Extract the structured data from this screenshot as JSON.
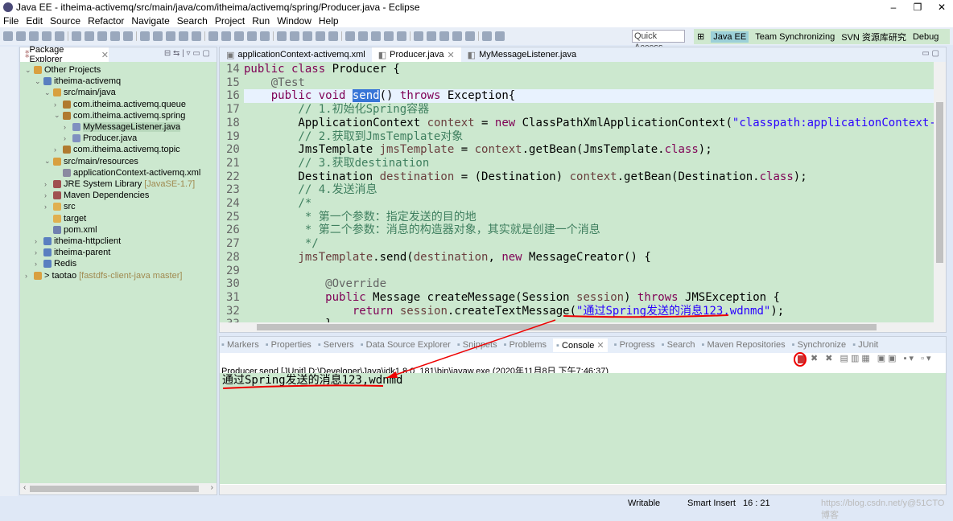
{
  "window": {
    "title": "Java EE - itheima-activemq/src/main/java/com/itheima/activemq/spring/Producer.java - Eclipse"
  },
  "menu": [
    "File",
    "Edit",
    "Source",
    "Refactor",
    "Navigate",
    "Search",
    "Project",
    "Run",
    "Window",
    "Help"
  ],
  "quick_access": "Quick Access",
  "perspectives": [
    "Java EE",
    "Team Synchronizing",
    "SVN 资源库研究",
    "Debug"
  ],
  "package_explorer": {
    "title": "Package Explorer",
    "tree": [
      {
        "label": "Other Projects",
        "depth": 0,
        "expanded": true,
        "icon": "working-set-icon"
      },
      {
        "label": "itheima-activemq",
        "depth": 1,
        "expanded": true,
        "icon": "project-icon"
      },
      {
        "label": "src/main/java",
        "depth": 2,
        "expanded": true,
        "icon": "source-folder-icon"
      },
      {
        "label": "com.itheima.activemq.queue",
        "depth": 3,
        "expanded": false,
        "icon": "package-icon"
      },
      {
        "label": "com.itheima.activemq.spring",
        "depth": 3,
        "expanded": true,
        "icon": "package-icon"
      },
      {
        "label": "MyMessageListener.java",
        "depth": 4,
        "expanded": false,
        "icon": "java-file-icon",
        "selected": true
      },
      {
        "label": "Producer.java",
        "depth": 4,
        "expanded": false,
        "icon": "java-file-icon"
      },
      {
        "label": "com.itheima.activemq.topic",
        "depth": 3,
        "expanded": false,
        "icon": "package-icon"
      },
      {
        "label": "src/main/resources",
        "depth": 2,
        "expanded": true,
        "icon": "source-folder-icon"
      },
      {
        "label": "applicationContext-activemq.xml",
        "depth": 3,
        "icon": "xml-file-icon"
      },
      {
        "label": "JRE System Library",
        "decoration": "[JavaSE-1.7]",
        "depth": 2,
        "expanded": false,
        "icon": "library-icon"
      },
      {
        "label": "Maven Dependencies",
        "depth": 2,
        "expanded": false,
        "icon": "library-icon"
      },
      {
        "label": "src",
        "depth": 2,
        "expanded": false,
        "icon": "folder-icon"
      },
      {
        "label": "target",
        "depth": 2,
        "icon": "folder-icon"
      },
      {
        "label": "pom.xml",
        "depth": 2,
        "icon": "pom-file-icon"
      },
      {
        "label": "itheima-httpclient",
        "depth": 1,
        "expanded": false,
        "icon": "project-icon"
      },
      {
        "label": "itheima-parent",
        "depth": 1,
        "expanded": false,
        "icon": "project-icon"
      },
      {
        "label": "Redis",
        "depth": 1,
        "expanded": false,
        "icon": "project-icon"
      },
      {
        "label": "> taotao",
        "decoration": "[fastdfs-client-java master]",
        "depth": 0,
        "expanded": false,
        "icon": "working-set-icon"
      }
    ]
  },
  "editor": {
    "tabs": [
      {
        "label": "applicationContext-activemq.xml"
      },
      {
        "label": "Producer.java",
        "active": true
      },
      {
        "label": "MyMessageListener.java"
      }
    ],
    "lines": [
      {
        "n": "14",
        "t": [
          [
            "k",
            "public class "
          ],
          [
            "p",
            "Producer {"
          ]
        ]
      },
      {
        "n": "15",
        "t": [
          [
            "p",
            "    "
          ],
          [
            "a",
            "@Test"
          ]
        ]
      },
      {
        "n": "16",
        "cur": true,
        "t": [
          [
            "p",
            "    "
          ],
          [
            "k",
            "public void "
          ],
          [
            "h",
            "send"
          ],
          [
            "p",
            "() "
          ],
          [
            "k",
            "throws "
          ],
          [
            "p",
            "Exception{"
          ]
        ]
      },
      {
        "n": "17",
        "t": [
          [
            "c",
            "        // 1.初始化Spring容器"
          ]
        ]
      },
      {
        "n": "18",
        "t": [
          [
            "p",
            "        ApplicationContext "
          ],
          [
            "v",
            "context"
          ],
          [
            "p",
            " = "
          ],
          [
            "k",
            "new "
          ],
          [
            "p",
            "ClassPathXmlApplicationContext("
          ],
          [
            "s",
            "\"classpath:applicationContext-activemq.xml\""
          ],
          [
            "p",
            ");"
          ]
        ]
      },
      {
        "n": "19",
        "t": [
          [
            "c",
            "        // 2.获取到JmsTemplate对象"
          ]
        ]
      },
      {
        "n": "20",
        "t": [
          [
            "p",
            "        JmsTemplate "
          ],
          [
            "v",
            "jmsTemplate"
          ],
          [
            "p",
            " = "
          ],
          [
            "v",
            "context"
          ],
          [
            "p",
            ".getBean(JmsTemplate."
          ],
          [
            "k",
            "class"
          ],
          [
            "p",
            ");"
          ]
        ]
      },
      {
        "n": "21",
        "t": [
          [
            "c",
            "        // 3.获取destination"
          ]
        ]
      },
      {
        "n": "22",
        "t": [
          [
            "p",
            "        Destination "
          ],
          [
            "v",
            "destination"
          ],
          [
            "p",
            " = (Destination) "
          ],
          [
            "v",
            "context"
          ],
          [
            "p",
            ".getBean(Destination."
          ],
          [
            "k",
            "class"
          ],
          [
            "p",
            ");"
          ]
        ]
      },
      {
        "n": "23",
        "t": [
          [
            "c",
            "        // 4.发送消息"
          ]
        ]
      },
      {
        "n": "24",
        "t": [
          [
            "c",
            "        /*"
          ]
        ]
      },
      {
        "n": "25",
        "t": [
          [
            "c",
            "         * 第一个参数：指定发送的目的地"
          ]
        ]
      },
      {
        "n": "26",
        "t": [
          [
            "c",
            "         * 第二个参数：消息的构造器对象，其实就是创建一个消息"
          ]
        ]
      },
      {
        "n": "27",
        "t": [
          [
            "c",
            "         */"
          ]
        ]
      },
      {
        "n": "28",
        "t": [
          [
            "v",
            "        jmsTemplate"
          ],
          [
            "p",
            ".send("
          ],
          [
            "v",
            "destination"
          ],
          [
            "p",
            ", "
          ],
          [
            "k",
            "new "
          ],
          [
            "p",
            "MessageCreator() {"
          ]
        ]
      },
      {
        "n": "29",
        "t": [
          [
            "p",
            ""
          ]
        ]
      },
      {
        "n": "30",
        "t": [
          [
            "p",
            "            "
          ],
          [
            "a",
            "@Override"
          ]
        ]
      },
      {
        "n": "31",
        "t": [
          [
            "p",
            "            "
          ],
          [
            "k",
            "public "
          ],
          [
            "p",
            "Message createMessage(Session "
          ],
          [
            "v",
            "session"
          ],
          [
            "p",
            ") "
          ],
          [
            "k",
            "throws "
          ],
          [
            "p",
            "JMSException {"
          ]
        ]
      },
      {
        "n": "32",
        "t": [
          [
            "p",
            "                "
          ],
          [
            "k",
            "return "
          ],
          [
            "v",
            "session"
          ],
          [
            "p",
            ".createTextMessage("
          ],
          [
            "s",
            "\"通过Spring发送的消息123,wdnmd\""
          ],
          [
            "p",
            ");"
          ]
        ]
      },
      {
        "n": "33",
        "t": [
          [
            "p",
            "            }"
          ]
        ]
      }
    ]
  },
  "console": {
    "tabs": [
      {
        "label": "Markers"
      },
      {
        "label": "Properties"
      },
      {
        "label": "Servers"
      },
      {
        "label": "Data Source Explorer"
      },
      {
        "label": "Snippets"
      },
      {
        "label": "Problems"
      },
      {
        "label": "Console",
        "active": true
      },
      {
        "label": "Progress"
      },
      {
        "label": "Search"
      },
      {
        "label": "Maven Repositories"
      },
      {
        "label": "Synchronize"
      },
      {
        "label": "JUnit"
      }
    ],
    "launch": "Producer.send [JUnit] D:\\Developer\\Java\\jdk1.8.0_181\\bin\\javaw.exe (2020年11月8日 下午7:46:37)",
    "output": "通过Spring发送的消息123,wdnmd"
  },
  "status": {
    "mode": "Writable",
    "insert": "Smart Insert",
    "position": "16 : 21",
    "watermark": "https://blog.csdn.net/y@51CTO博客"
  },
  "colors": {
    "editor_bg": "#cce8cf",
    "keyword": "#7f0055",
    "comment": "#3f7f5f",
    "string": "#2a00ff",
    "annotation": "#ff0000"
  }
}
